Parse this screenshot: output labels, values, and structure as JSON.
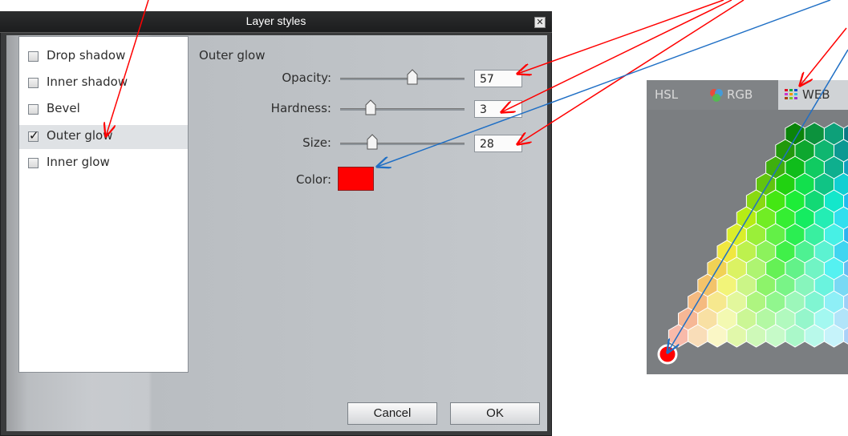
{
  "dialog": {
    "title": "Layer styles",
    "effects": [
      {
        "label": "Drop shadow",
        "checked": false
      },
      {
        "label": "Inner shadow",
        "checked": false
      },
      {
        "label": "Bevel",
        "checked": false
      },
      {
        "label": "Outer glow",
        "checked": true,
        "selected": true
      },
      {
        "label": "Inner glow",
        "checked": false
      }
    ],
    "section_title": "Outer glow",
    "opacity": {
      "label": "Opacity:",
      "value": "57"
    },
    "hardness": {
      "label": "Hardness:",
      "value": "3"
    },
    "size": {
      "label": "Size:",
      "value": "28"
    },
    "color": {
      "label": "Color:",
      "value": "#ff0000"
    },
    "cancel_label": "Cancel",
    "ok_label": "OK"
  },
  "picker": {
    "tabs": [
      {
        "label": "HSL",
        "icon": "hsl-icon"
      },
      {
        "label": "RGB",
        "icon": "rgb-circles-icon"
      },
      {
        "label": "WEB",
        "icon": "web-grid-icon",
        "active": true
      }
    ],
    "selected_color": "#ff0000"
  },
  "colors": {
    "annotation_red": "#ff0000",
    "annotation_blue": "#1f6fc5"
  }
}
